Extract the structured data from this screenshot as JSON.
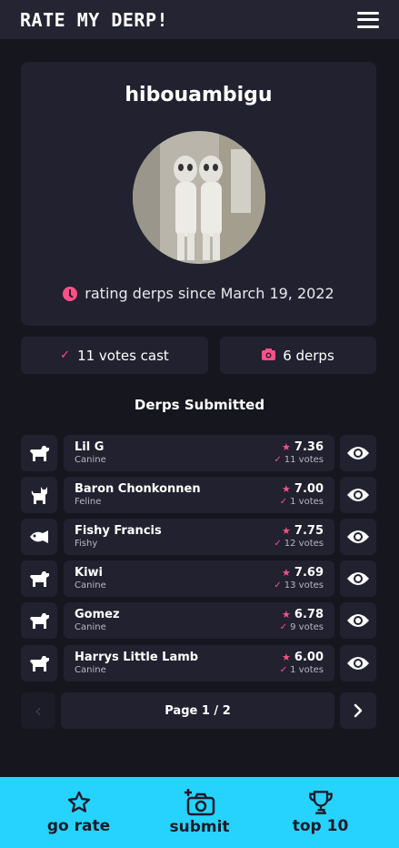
{
  "header": {
    "brand": "RATE MY DERP!"
  },
  "profile": {
    "username": "hibouambigu",
    "since_text": "rating derps since March 19, 2022"
  },
  "stats": {
    "votes_cast": "11 votes cast",
    "derps": "6 derps"
  },
  "section_title": "Derps Submitted",
  "derps": [
    {
      "name": "Lil G",
      "kind": "Canine",
      "score": "7.36",
      "votes": "11 votes",
      "icon": "dog-icon"
    },
    {
      "name": "Baron Chonkonnen",
      "kind": "Feline",
      "score": "7.00",
      "votes": "1 votes",
      "icon": "cat-icon"
    },
    {
      "name": "Fishy Francis",
      "kind": "Fishy",
      "score": "7.75",
      "votes": "12 votes",
      "icon": "fish-icon"
    },
    {
      "name": "Kiwi",
      "kind": "Canine",
      "score": "7.69",
      "votes": "13 votes",
      "icon": "dog-icon"
    },
    {
      "name": "Gomez",
      "kind": "Canine",
      "score": "6.78",
      "votes": "9 votes",
      "icon": "dog-icon"
    },
    {
      "name": "Harrys Little Lamb",
      "kind": "Canine",
      "score": "6.00",
      "votes": "1 votes",
      "icon": "dog-icon"
    }
  ],
  "pager": {
    "label": "Page 1 / 2"
  },
  "nav": {
    "rate": "go rate",
    "submit": "submit",
    "top": "top 10"
  },
  "colors": {
    "accent": "#ff4f87",
    "nav_bg": "#26d3ff",
    "card_bg": "#212130",
    "page_bg": "#16161f"
  }
}
